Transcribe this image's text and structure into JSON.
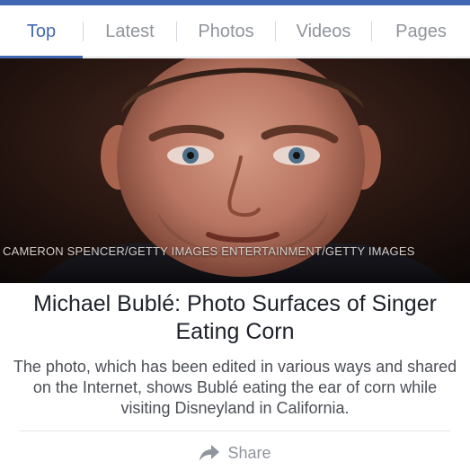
{
  "tabs": [
    {
      "label": "Top",
      "active": true
    },
    {
      "label": "Latest",
      "active": false
    },
    {
      "label": "Photos",
      "active": false
    },
    {
      "label": "Videos",
      "active": false
    },
    {
      "label": "Pages",
      "active": false
    }
  ],
  "photo": {
    "credit": "CAMERON SPENCER/GETTY IMAGES ENTERTAINMENT/GETTY IMAGES"
  },
  "article": {
    "headline": "Michael Bublé: Photo Surfaces of Singer Eating Corn",
    "description": "The photo, which has been edited in various ways and shared on the Internet, shows Bublé eating the ear of corn while visiting Disneyland in California."
  },
  "actions": {
    "share_label": "Share",
    "share_icon": "share-arrow-icon"
  },
  "colors": {
    "accent": "#4267b2",
    "muted": "#90949c",
    "headline": "#1d2129",
    "body": "#4b4f56"
  }
}
